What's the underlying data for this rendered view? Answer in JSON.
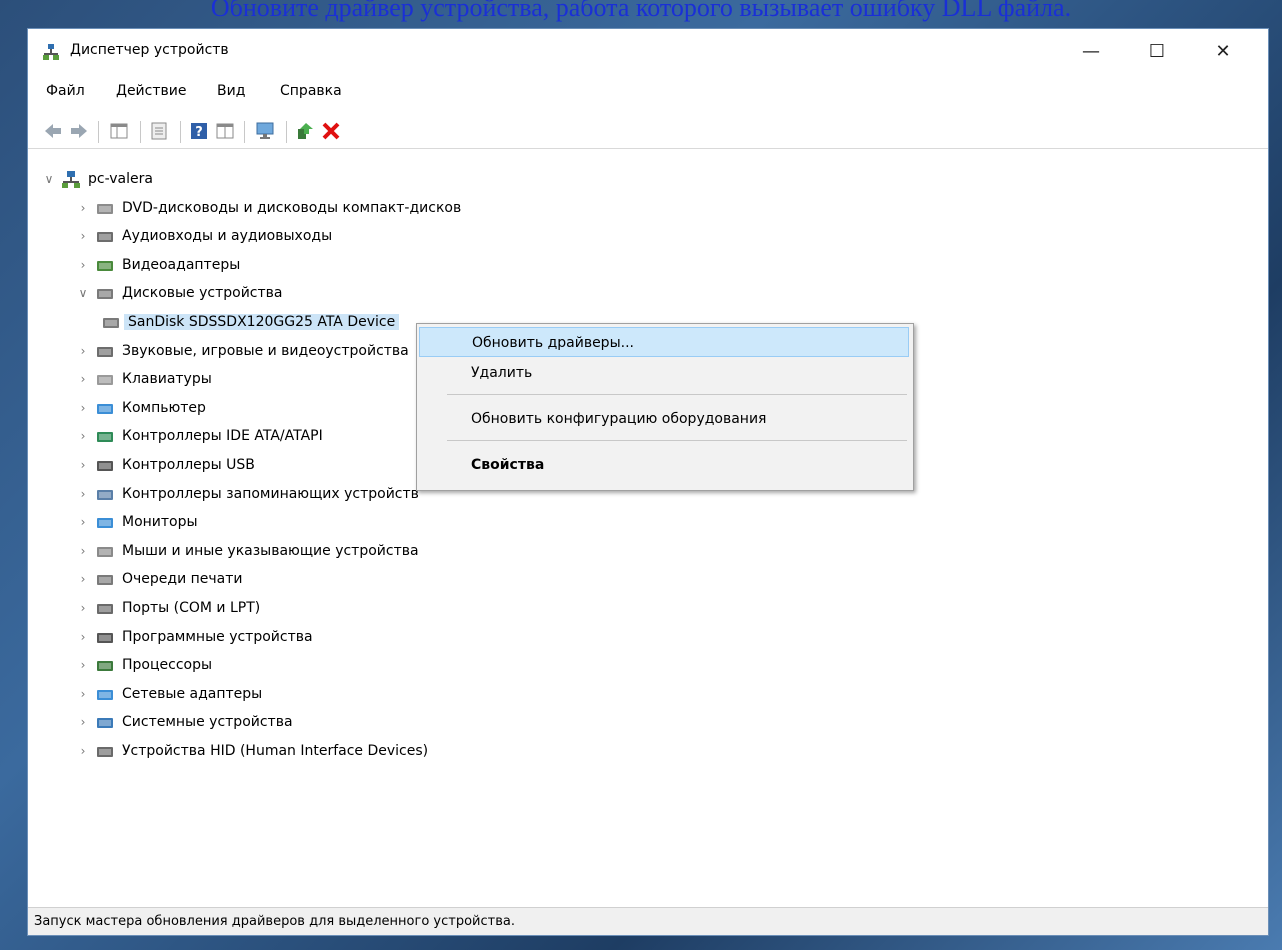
{
  "caption": "Обновите драйвер устройства, работа которого вызывает ошибку DLL файла.",
  "window": {
    "title": "Диспетчер устройств",
    "controls": {
      "minimize": "—",
      "maximize": "☐",
      "close": "✕"
    }
  },
  "menu": {
    "file": "Файл",
    "action": "Действие",
    "view": "Вид",
    "help": "Справка"
  },
  "tree": {
    "root": "pc-valera",
    "items": [
      {
        "label": "DVD-дисководы и дисководы компакт-дисков",
        "icon": "dvd-icon"
      },
      {
        "label": "Аудиовходы и аудиовыходы",
        "icon": "speaker-icon"
      },
      {
        "label": "Видеоадаптеры",
        "icon": "display-adapter-icon"
      },
      {
        "label": "Дисковые устройства",
        "icon": "disk-drive-icon",
        "expanded": true
      },
      {
        "label": "SanDisk SDSSDX120GG25 ATA Device",
        "icon": "disk-drive-icon",
        "child": true
      },
      {
        "label": "Звуковые, игровые и видеоустройства",
        "icon": "speaker-icon"
      },
      {
        "label": "Клавиатуры",
        "icon": "keyboard-icon"
      },
      {
        "label": "Компьютер",
        "icon": "computer-icon"
      },
      {
        "label": "Контроллеры IDE ATA/ATAPI",
        "icon": "ide-controller-icon"
      },
      {
        "label": "Контроллеры USB",
        "icon": "usb-icon"
      },
      {
        "label": "Контроллеры запоминающих устройств",
        "icon": "storage-controller-icon"
      },
      {
        "label": "Мониторы",
        "icon": "monitor-icon"
      },
      {
        "label": "Мыши и иные указывающие устройства",
        "icon": "mouse-icon"
      },
      {
        "label": "Очереди печати",
        "icon": "printer-icon"
      },
      {
        "label": "Порты (COM и LPT)",
        "icon": "port-icon"
      },
      {
        "label": "Программные устройства",
        "icon": "software-device-icon"
      },
      {
        "label": "Процессоры",
        "icon": "processor-icon"
      },
      {
        "label": "Сетевые адаптеры",
        "icon": "network-adapter-icon"
      },
      {
        "label": "Системные устройства",
        "icon": "system-device-icon"
      },
      {
        "label": "Устройства HID (Human Interface Devices)",
        "icon": "hid-icon"
      }
    ]
  },
  "context_menu": {
    "update_drivers": "Обновить драйверы...",
    "delete": "Удалить",
    "scan_hardware": "Обновить конфигурацию оборудования",
    "properties": "Свойства"
  },
  "status": "Запуск мастера обновления драйверов для выделенного устройства."
}
